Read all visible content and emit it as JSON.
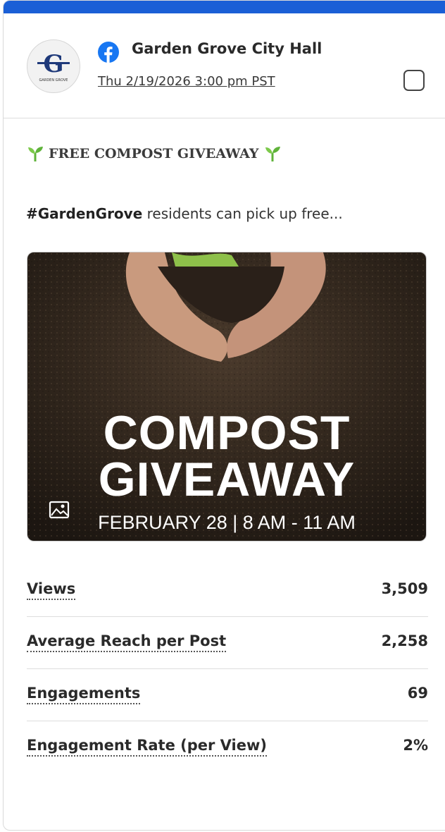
{
  "colors": {
    "accent_bar": "#1a5fd6",
    "facebook_blue": "#1877f2",
    "sprout_green": "#5fb33a"
  },
  "post": {
    "page_name": "Garden Grove City Hall",
    "timestamp": "Thu 2/19/2026 3:00 pm PST",
    "platform_icon": "facebook-icon",
    "avatar_logo_letter": "G",
    "avatar_logo_caption": "GARDEN GROVE",
    "headline": "FREE COMPOST GIVEAWAY",
    "headline_emoji_icon": "seedling-icon",
    "body_hashtag": "#GardenGrove",
    "body_text": " residents can pick up free..."
  },
  "image": {
    "title_line1": "COMPOST",
    "title_line2": "GIVEAWAY",
    "date_line": "FEBRUARY 28  |  8 AM - 11 AM",
    "media_type_icon": "image-icon"
  },
  "stats": [
    {
      "label": "Views",
      "value": "3,509"
    },
    {
      "label": "Average Reach per Post",
      "value": "2,258"
    },
    {
      "label": "Engagements",
      "value": "69"
    },
    {
      "label": "Engagement Rate (per View)",
      "value": "2%"
    }
  ]
}
